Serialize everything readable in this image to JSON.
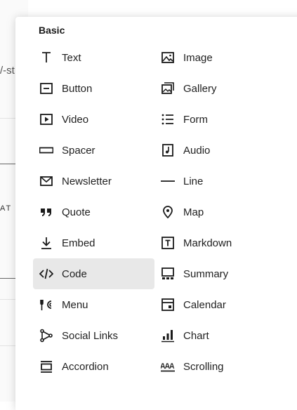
{
  "background": {
    "fragment_top": "/-st",
    "fragment_mid": "AT Y"
  },
  "picker": {
    "section_title": "Basic",
    "selected": "Code",
    "items": [
      {
        "label": "Text",
        "icon": "text-icon"
      },
      {
        "label": "Image",
        "icon": "image-icon"
      },
      {
        "label": "Button",
        "icon": "button-icon"
      },
      {
        "label": "Gallery",
        "icon": "gallery-icon"
      },
      {
        "label": "Video",
        "icon": "video-icon"
      },
      {
        "label": "Form",
        "icon": "form-icon"
      },
      {
        "label": "Spacer",
        "icon": "spacer-icon"
      },
      {
        "label": "Audio",
        "icon": "audio-icon"
      },
      {
        "label": "Newsletter",
        "icon": "newsletter-icon"
      },
      {
        "label": "Line",
        "icon": "line-icon"
      },
      {
        "label": "Quote",
        "icon": "quote-icon"
      },
      {
        "label": "Map",
        "icon": "map-pin-icon"
      },
      {
        "label": "Embed",
        "icon": "embed-icon"
      },
      {
        "label": "Markdown",
        "icon": "markdown-icon"
      },
      {
        "label": "Code",
        "icon": "code-icon"
      },
      {
        "label": "Summary",
        "icon": "summary-icon"
      },
      {
        "label": "Menu",
        "icon": "menu-icon"
      },
      {
        "label": "Calendar",
        "icon": "calendar-icon"
      },
      {
        "label": "Social Links",
        "icon": "social-links-icon"
      },
      {
        "label": "Chart",
        "icon": "chart-icon"
      },
      {
        "label": "Accordion",
        "icon": "accordion-icon"
      },
      {
        "label": "Scrolling",
        "icon": "scrolling-icon"
      }
    ]
  }
}
